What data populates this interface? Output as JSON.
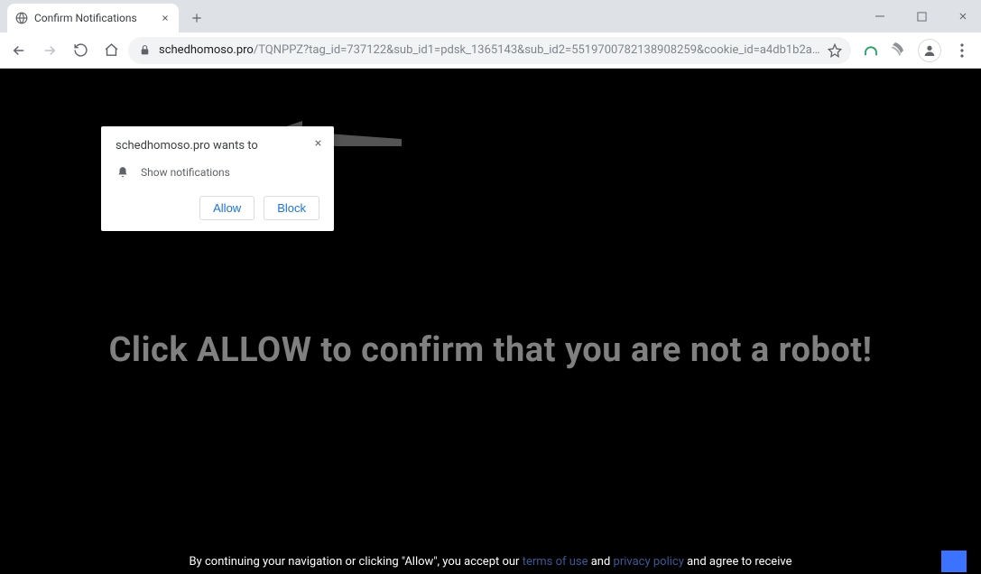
{
  "window": {
    "tab_title": "Confirm Notifications"
  },
  "omnibox": {
    "host": "schedhomoso.pro",
    "path": "/TQNPPZ?tag_id=737122&sub_id1=pdsk_1365143&sub_id2=5519700782138908259&cookie_id=a4db1b2a-6854-48bd-a826-3419cecf333..."
  },
  "permission": {
    "wants_to": "schedhomoso.pro wants to",
    "row_label": "Show notifications",
    "allow": "Allow",
    "block": "Block"
  },
  "page": {
    "headline": "Click ALLOW to confirm that you are not a robot!",
    "footer_pre": "By continuing your navigation or clicking \"Allow\", you accept our ",
    "terms": "terms of use",
    "and": " and ",
    "privacy": "privacy policy",
    "footer_post": " and agree to receive"
  }
}
